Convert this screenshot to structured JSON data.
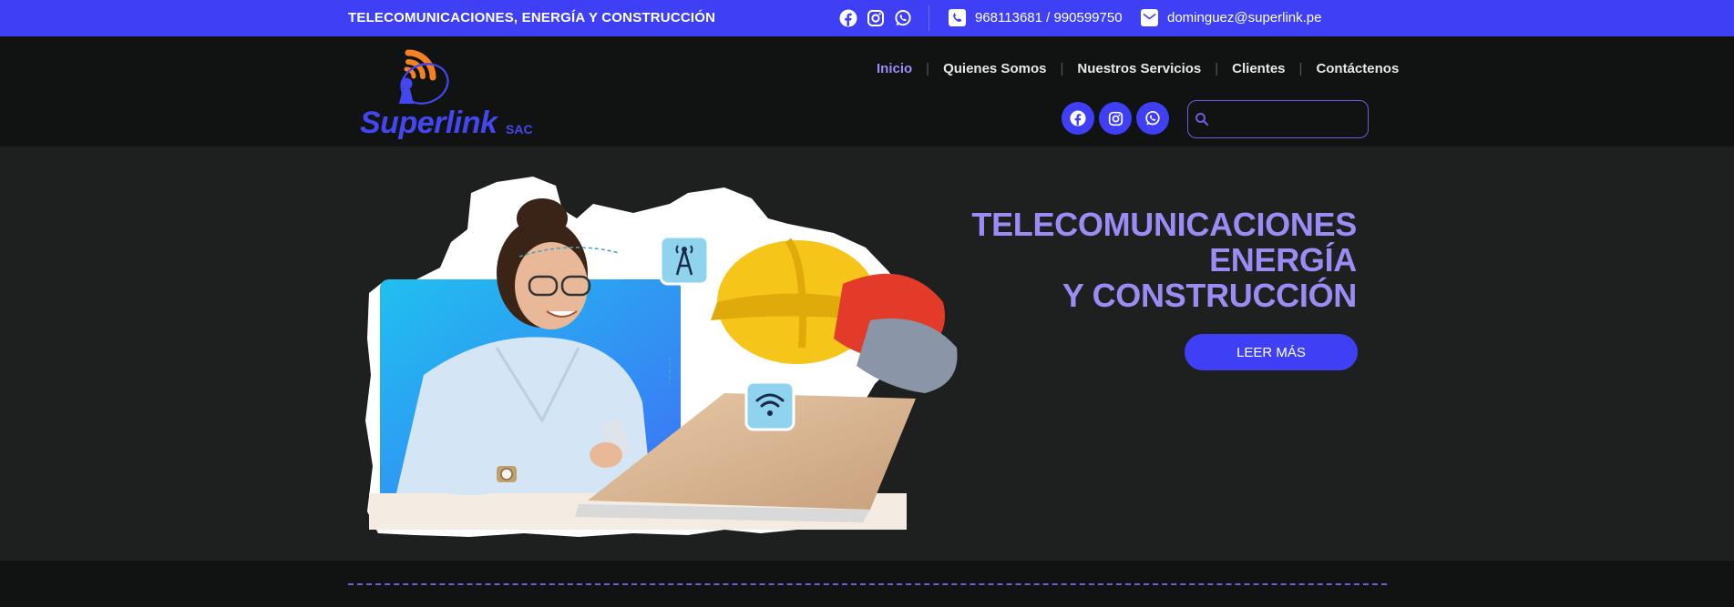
{
  "topbar": {
    "tagline": "TELECOMUNICACIONES, ENERGÍA Y CONSTRUCCIÓN",
    "social_icons": [
      "facebook-icon",
      "instagram-icon",
      "whatsapp-icon"
    ],
    "phone": "968113681 / 990599750",
    "email": "dominguez@superlink.pe",
    "background": "#3f3ff5"
  },
  "brand": {
    "name": "Superlink",
    "suffix": "SAC",
    "primary_color": "#4447f0",
    "secondary_color": "#f58220"
  },
  "nav": {
    "items": [
      {
        "label": "Inicio",
        "active": true
      },
      {
        "label": "Quienes Somos",
        "active": false
      },
      {
        "label": "Nuestros Servicios",
        "active": false
      },
      {
        "label": "Clientes",
        "active": false
      },
      {
        "label": "Contáctenos",
        "active": false
      }
    ],
    "active_color": "#9b8cf5"
  },
  "header_social": [
    "facebook-icon",
    "instagram-icon",
    "whatsapp-icon"
  ],
  "search": {
    "placeholder": "",
    "value": ""
  },
  "hero": {
    "title_lines": [
      "TELECOMUNICACIONES",
      "ENERGÍA",
      "Y CONSTRUCCIÓN"
    ],
    "cta_label": "LEER MÁS",
    "title_color": "#9b8cf5",
    "art_icons": [
      "antenna-icon",
      "wifi-icon"
    ]
  }
}
